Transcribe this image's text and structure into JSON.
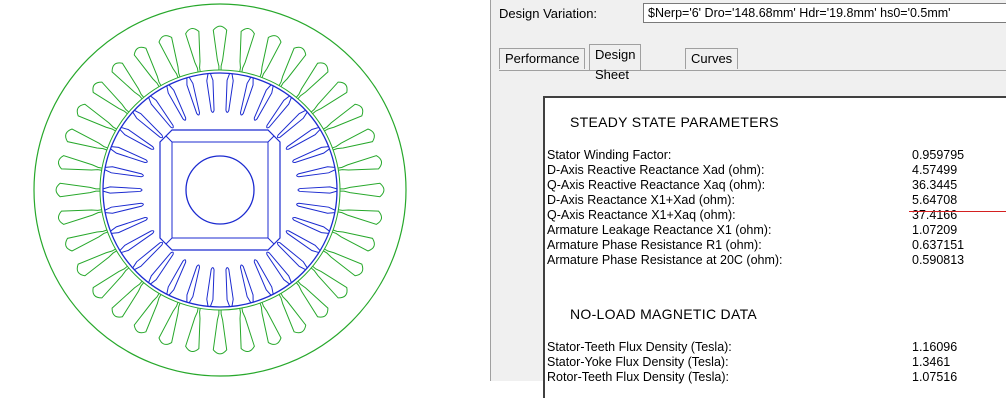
{
  "colors": {
    "stator": "#27a82b",
    "rotor": "#1c2bd0",
    "marker": "#d42020"
  },
  "design_variation": {
    "label": "Design Variation:",
    "value": "$Nerp='6' Dro='148.68mm' Hdr='19.8mm' hs0='0.5mm'"
  },
  "tabs": [
    {
      "label": "Performance"
    },
    {
      "label": "Design Sheet"
    },
    {
      "label": "Curves"
    }
  ],
  "sheet": {
    "steady_title": "STEADY STATE PARAMETERS",
    "steady_rows": [
      {
        "label": "Stator Winding Factor:",
        "value": "0.959795"
      },
      {
        "label": "D-Axis Reactive Reactance Xad (ohm):",
        "value": "4.57499"
      },
      {
        "label": "Q-Axis Reactive Reactance Xaq (ohm):",
        "value": "36.3445"
      },
      {
        "label": "D-Axis Reactance X1+Xad (ohm):",
        "value": "5.64708"
      },
      {
        "label": "Q-Axis Reactance X1+Xaq (ohm):",
        "value": "37.4166"
      },
      {
        "label": "Armature Leakage Reactance X1 (ohm):",
        "value": "1.07209"
      },
      {
        "label": "Armature Phase Resistance R1 (ohm):",
        "value": "0.637151"
      },
      {
        "label": "Armature Phase Resistance at 20C (ohm):",
        "value": "0.590813"
      }
    ],
    "noload_title": "NO-LOAD MAGNETIC DATA",
    "noload_rows": [
      {
        "label": "Stator-Teeth Flux Density (Tesla):",
        "value": "1.16096"
      },
      {
        "label": "Stator-Yoke Flux Density (Tesla):",
        "value": "1.3461"
      },
      {
        "label": "Rotor-Teeth Flux Density (Tesla):",
        "value": "1.07516"
      }
    ]
  }
}
